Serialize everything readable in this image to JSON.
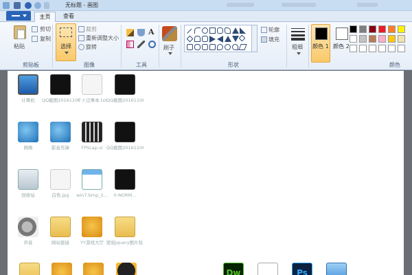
{
  "window": {
    "title": "无标题 - 画图"
  },
  "tabs": [
    {
      "label": "主页",
      "active": true
    },
    {
      "label": "查看",
      "active": false
    }
  ],
  "ribbon": {
    "clipboard": {
      "paste": "粘贴",
      "cut": "剪切",
      "copy": "复制",
      "group": "剪贴板"
    },
    "image": {
      "select": "选择",
      "crop": "裁剪",
      "resize": "重新调整大小",
      "rotate": "旋转",
      "group": "图像"
    },
    "tools": {
      "group": "工具"
    },
    "brushes": {
      "label": "刷子"
    },
    "shapes": {
      "outline": "轮廓",
      "fill": "填充",
      "group": "形状"
    },
    "size": {
      "label": "粗细"
    },
    "colors": {
      "color1": "颜色 1",
      "color2": "颜色 2",
      "group": "颜色"
    }
  },
  "palette": {
    "row1": [
      "#000000",
      "#7f7f7f",
      "#880015",
      "#ed1c24",
      "#ff7f27",
      "#fff200"
    ],
    "row2": [
      "#ffffff",
      "#c3c3c3",
      "#b97a57",
      "#ffaec9",
      "#ffc90e",
      "#efe4b0"
    ],
    "row3": [
      "#ffffff",
      "#ffffff",
      "#ffffff",
      "#ffffff",
      "#ffffff",
      "#ffffff"
    ]
  },
  "desktop_icons": [
    {
      "label": "计算机",
      "icon": "computer-icon"
    },
    {
      "label": "QQ截图20161106...",
      "icon": "image-icon"
    },
    {
      "label": "个人记事本.txt",
      "icon": "text-file-icon"
    },
    {
      "label": "QQ截图20161106...",
      "icon": "image-icon"
    },
    {
      "label": "网络",
      "icon": "network-icon"
    },
    {
      "label": "影音先锋",
      "icon": "media-player-icon"
    },
    {
      "label": "FPSLap.vi",
      "icon": "video-file-icon"
    },
    {
      "label": "QQ截图20161106...",
      "icon": "image-icon"
    },
    {
      "label": "回收站",
      "icon": "recycle-bin-icon"
    },
    {
      "label": "白色.jpg",
      "icon": "image-icon"
    },
    {
      "label": "win7.bmp_2...",
      "icon": "image-icon"
    },
    {
      "label": "0-NORM...",
      "icon": "image-icon"
    },
    {
      "label": "声音",
      "icon": "speaker-icon"
    },
    {
      "label": "网站链接",
      "icon": "folder-icon"
    },
    {
      "label": "YY游戏大厅",
      "icon": "game-icon"
    },
    {
      "label": "壁纸jquery图片轮...",
      "icon": "folder-icon"
    }
  ],
  "bottom_icons": [
    {
      "icon": "folder-icon"
    },
    {
      "icon": "qq-pet-icon"
    },
    {
      "icon": "game-icon"
    },
    {
      "icon": "qq-icon"
    },
    {
      "icon": "dreamweaver-icon",
      "text": "Dw"
    },
    {
      "icon": "notepad-icon"
    },
    {
      "icon": "photoshop-icon",
      "text": "Ps"
    },
    {
      "icon": "app-icon"
    }
  ]
}
